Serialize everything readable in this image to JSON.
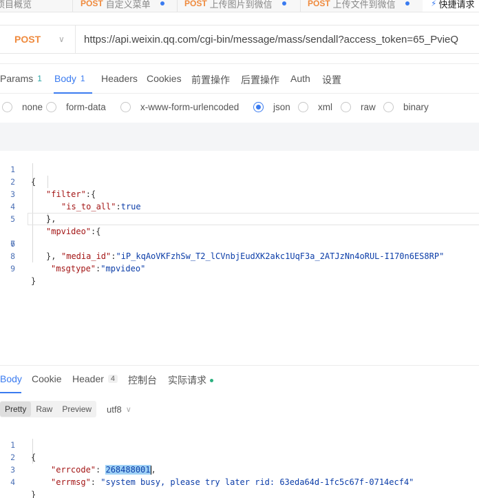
{
  "top_tabs": [
    {
      "method": "",
      "name": "项目概览"
    },
    {
      "method": "POST",
      "name": "自定义菜单"
    },
    {
      "method": "POST",
      "name": "上传图片到微信"
    },
    {
      "method": "POST",
      "name": "上传文件到微信"
    }
  ],
  "quick_tab": {
    "label": "快捷请求"
  },
  "request": {
    "method": "POST",
    "url": "https://api.weixin.qq.com/cgi-bin/message/mass/sendall?access_token=65_PvieQ"
  },
  "request_tabs": [
    {
      "label": "Params",
      "count": "1"
    },
    {
      "label": "Body",
      "count": "1"
    },
    {
      "label": "Headers",
      "count": ""
    },
    {
      "label": "Cookies",
      "count": ""
    },
    {
      "label": "前置操作",
      "count": ""
    },
    {
      "label": "后置操作",
      "count": ""
    },
    {
      "label": "Auth",
      "count": ""
    },
    {
      "label": "设置",
      "count": ""
    }
  ],
  "body_types": [
    "none",
    "form-data",
    "x-www-form-urlencoded",
    "json",
    "xml",
    "raw",
    "binary"
  ],
  "selected_body_type": "json",
  "request_body": {
    "line_numbers": [
      "1",
      "2",
      "3",
      "4",
      "5",
      "6",
      "7",
      "8",
      "9"
    ],
    "keys": {
      "filter": "\"filter\"",
      "is_to_all": "\"is_to_all\"",
      "mpvideo": "\"mpvideo\"",
      "media_id": "\"media_id\"",
      "msgtype": "\"msgtype\""
    },
    "values": {
      "is_to_all": "true",
      "media_id": "\"iP_kqAoVKFzhSw_T2_lCVnbjEudXK2akc1UqF3a_2ATJzNn4oRUL-I170n6ES8RP\"",
      "msgtype": "\"mpvideo\""
    }
  },
  "response_tabs": [
    {
      "label": "Body",
      "badge": ""
    },
    {
      "label": "Cookie",
      "badge": ""
    },
    {
      "label": "Header",
      "badge": "4"
    },
    {
      "label": "控制台",
      "badge": ""
    },
    {
      "label": "实际请求",
      "badge": ""
    }
  ],
  "response_formats": [
    "Pretty",
    "Raw",
    "Preview"
  ],
  "response_encoding": "utf8",
  "response_body": {
    "line_numbers": [
      "1",
      "2",
      "3",
      "4"
    ],
    "errcode_key": "\"errcode\"",
    "errcode_value": "268488001",
    "errmsg_key": "\"errmsg\"",
    "errmsg_value": "\"system busy, please try later rid: 63eda64d-1fc5c67f-0714ecf4\""
  }
}
